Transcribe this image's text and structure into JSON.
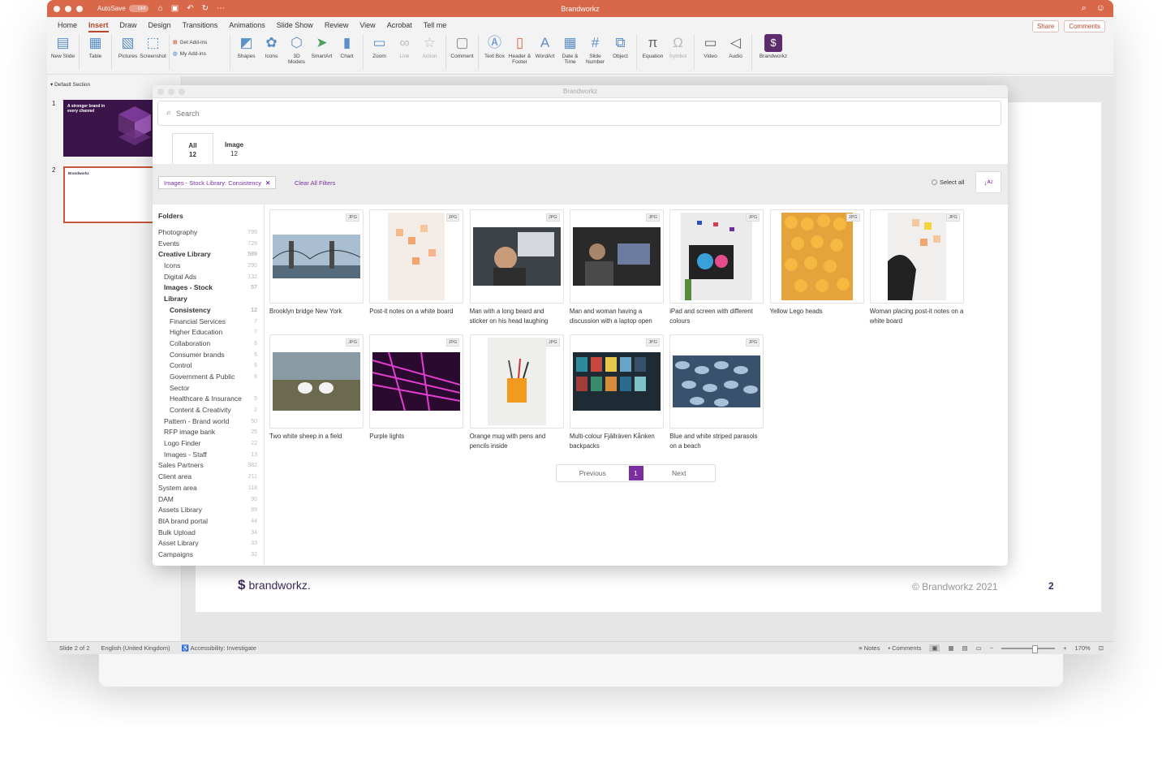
{
  "titlebar": {
    "autosave": "AutoSave",
    "toggle": "OFF",
    "title": "Brandworkz"
  },
  "tabs": [
    "Home",
    "Insert",
    "Draw",
    "Design",
    "Transitions",
    "Animations",
    "Slide Show",
    "Review",
    "View",
    "Acrobat",
    "Tell me"
  ],
  "tab_actions": {
    "share": "Share",
    "comments": "Comments"
  },
  "ribbon": {
    "new_slide": "New Slide",
    "table": "Table",
    "pictures": "Pictures",
    "screenshot": "Screenshot",
    "get_addins": "Get Add-ins",
    "my_addins": "My Add-ins",
    "shapes": "Shapes",
    "icons": "Icons",
    "models": "3D Models",
    "smartart": "SmartArt",
    "chart": "Chart",
    "zoom": "Zoom",
    "link": "Link",
    "action": "Action",
    "comment": "Comment",
    "textbox": "Text Box",
    "header_footer": "Header & Footer",
    "wordart": "WordArt",
    "date_time": "Date & Time",
    "slide_number": "Slide Number",
    "object": "Object",
    "equation": "Equation",
    "symbol": "Symbol",
    "video": "Video",
    "audio": "Audio",
    "brandworkz": "Brandworkz"
  },
  "thumbs": {
    "section": "Default Section",
    "slide1_num": "1",
    "slide2_num": "2",
    "slide1_title": "A stronger brand in every channel",
    "slide2_title": "Brandworkz"
  },
  "slide": {
    "logo": "brandworkz.",
    "copyright": "© Brandworkz 2021",
    "page": "2"
  },
  "status": {
    "slide": "Slide 2 of 2",
    "language": "English (United Kingdom)",
    "accessibility": "Accessibility: Investigate",
    "notes": "Notes",
    "comments": "Comments",
    "zoom": "170%"
  },
  "dialog": {
    "title": "Brandworkz",
    "search_placeholder": "Search",
    "tabs": [
      {
        "label": "All",
        "count": "12"
      },
      {
        "label": "Image",
        "count": "12"
      }
    ],
    "filter_chip": "Images - Stock Library: Consistency",
    "clear_filters": "Clear All Filters",
    "select_all": "Select all",
    "folders_heading": "Folders",
    "folders": [
      {
        "name": "Photography",
        "count": "799"
      },
      {
        "name": "Events",
        "count": "728"
      },
      {
        "name": "Creative Library",
        "count": "589"
      },
      {
        "name": "Icons",
        "count": "290"
      },
      {
        "name": "Digital Ads",
        "count": "132"
      },
      {
        "name": "Images - Stock",
        "count": "57"
      },
      {
        "name": "Library",
        "count": ""
      },
      {
        "name": "Consistency",
        "count": "12"
      },
      {
        "name": "Financial Services",
        "count": "7"
      },
      {
        "name": "Higher Education",
        "count": "7"
      },
      {
        "name": "Collaboration",
        "count": "6"
      },
      {
        "name": "Consumer brands",
        "count": "6"
      },
      {
        "name": "Control",
        "count": "6"
      },
      {
        "name": "Government & Public",
        "count": "6"
      },
      {
        "name": "Sector",
        "count": ""
      },
      {
        "name": "Healthcare & Insurance",
        "count": "5"
      },
      {
        "name": "Content & Creativity",
        "count": "2"
      },
      {
        "name": "Pattern - Brand world",
        "count": "50"
      },
      {
        "name": "RFP image bank",
        "count": "25"
      },
      {
        "name": "Logo Finder",
        "count": "22"
      },
      {
        "name": "Images - Staff",
        "count": "13"
      },
      {
        "name": "Sales Partners",
        "count": "382"
      },
      {
        "name": "Client area",
        "count": "211"
      },
      {
        "name": "System area",
        "count": "118"
      },
      {
        "name": "DAM",
        "count": "90"
      },
      {
        "name": "Assets Library",
        "count": "89"
      },
      {
        "name": "BIA brand portal",
        "count": "44"
      },
      {
        "name": "Bulk Upload",
        "count": "34"
      },
      {
        "name": "Asset Library",
        "count": "33"
      },
      {
        "name": "Campaigns",
        "count": "32"
      }
    ],
    "assets": [
      {
        "badge": "JPG",
        "caption": "Brooklyn bridge New York"
      },
      {
        "badge": "JPG",
        "caption": "Post-it notes on a white board"
      },
      {
        "badge": "JPG",
        "caption": "Man with a long beard and sticker on his head laughing"
      },
      {
        "badge": "JPG",
        "caption": "Man and woman having a discussion with a laptop open"
      },
      {
        "badge": "JPG",
        "caption": "iPad and screen with different colours"
      },
      {
        "badge": "JPG",
        "caption": "Yellow Lego heads"
      },
      {
        "badge": "JPG",
        "caption": "Woman placing post-it notes on a white board"
      },
      {
        "badge": "JPG",
        "caption": "Two white sheep in a field"
      },
      {
        "badge": "JPG",
        "caption": "Purple lights"
      },
      {
        "badge": "JPG",
        "caption": "Orange mug with pens and pencils inside"
      },
      {
        "badge": "JPG",
        "caption": "Multi-colour Fjällräven Kånken backpacks"
      },
      {
        "badge": "JPG",
        "caption": "Blue and white striped parasols on a beach"
      }
    ],
    "pager": {
      "prev": "Previous",
      "page": "1",
      "next": "Next"
    }
  },
  "colors": {
    "titlebar": "#d9684a",
    "accent": "#7a2ea0",
    "ppt_red": "#b7472a"
  }
}
